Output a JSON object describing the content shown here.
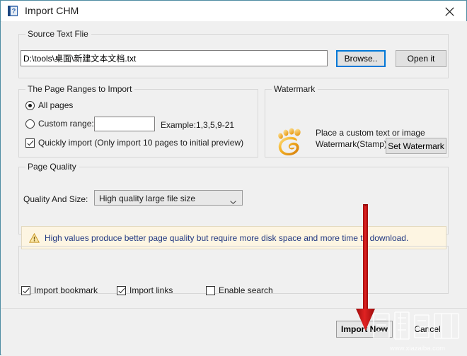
{
  "window": {
    "title": "Import CHM",
    "icon": "chm-book-icon",
    "close_label": "✕",
    "border_color": "#4e8ca2",
    "background": "#f0f0f0"
  },
  "source_group": {
    "title": "Source Text Flie",
    "path_value": "D:\\tools\\桌面\\新建文本文档.txt",
    "path_placeholder": "",
    "browse_label": "Browse..",
    "open_label": "Open it",
    "focus_color": "#0078d7"
  },
  "page_ranges_group": {
    "title": "The Page Ranges to Import",
    "all_pages_label": "All pages",
    "all_pages_checked": true,
    "custom_range_label": "Custom range:",
    "custom_range_checked": false,
    "custom_range_value": "",
    "example_label": "Example:1,3,5,9-21",
    "quickly_import_label": "Quickly import (Only import 10 pages to  initial  preview)",
    "quickly_import_checked": true
  },
  "watermark_group": {
    "title": "Watermark",
    "icon": "footprint-icon",
    "description_line1": "Place a custom text or image",
    "description_line2": "Watermark(Stamp) to the file(s)",
    "set_watermark_label": "Set Watermark"
  },
  "page_quality_group": {
    "title": "Page Quality",
    "quality_label": "Quality And Size:",
    "quality_value": "High quality large file size",
    "quality_options": [
      "High quality large file size"
    ]
  },
  "warning": {
    "icon": "warning-triangle-icon",
    "text": "High values produce better page quality but require more disk space and more time to download.",
    "text_color": "#1f3680",
    "background": "#fdf5e2"
  },
  "options_group": {
    "import_bookmark_label": "Import bookmark",
    "import_bookmark_checked": true,
    "import_links_label": "Import links",
    "import_links_checked": true,
    "enable_search_label": "Enable search",
    "enable_search_checked": false
  },
  "footer": {
    "import_now_label": "Import Now",
    "cancel_label": "Cancel"
  },
  "annotation": {
    "arrow_color": "#cc1414",
    "points_to": "Import Now"
  },
  "site_watermark": {
    "logo_text": "下载吧",
    "url_text": "www.xiazaiba.com"
  }
}
